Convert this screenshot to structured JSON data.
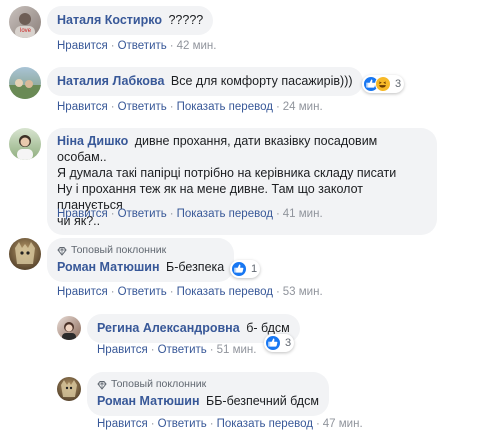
{
  "comments": [
    {
      "author": "Наталя Костирко",
      "text": "?????",
      "actions": {
        "like": "Нравится",
        "reply": "Ответить",
        "time": "42 мин."
      }
    },
    {
      "author": "Наталия Лабкова",
      "text": "Все для комфорту пасажирів)))",
      "reactions_count": "3",
      "actions": {
        "like": "Нравится",
        "reply": "Ответить",
        "translate": "Показать перевод",
        "time": "24 мин."
      }
    },
    {
      "author": "Ніна Дишко",
      "text": "дивне прохання, дати вказівку посадовим особам.. Я думала такі папірці потрібно на керівника складу писати Ну і прохання теж як на мене дивне. Там що заколот планується чи як?..",
      "lines": [
        "дивне прохання, дати вказівку посадовим особам..",
        "Я думала такі папірці потрібно на керівника складу писати",
        "Ну і прохання теж як на мене дивне. Там що заколот планується",
        "чи як?.."
      ],
      "actions": {
        "like": "Нравится",
        "reply": "Ответить",
        "translate": "Показать перевод",
        "time": "41 мин."
      }
    },
    {
      "badge": "Топовый поклонник",
      "author": "Роман Матюшин",
      "text": "Б-безпека",
      "reactions_count": "1",
      "actions": {
        "like": "Нравится",
        "reply": "Ответить",
        "translate": "Показать перевод",
        "time": "53 мин."
      }
    },
    {
      "author": "Регина Александровна",
      "text": "б- бдсм",
      "reactions_count": "3",
      "actions": {
        "like": "Нравится",
        "reply": "Ответить",
        "time": "51 мин."
      }
    },
    {
      "badge": "Топовый поклонник",
      "author": "Роман Матюшин",
      "text": "ББ-безпечний бдсм",
      "actions": {
        "like": "Нравится",
        "reply": "Ответить",
        "translate": "Показать перевод",
        "time": "47 мин."
      }
    }
  ],
  "separator": "·",
  "colors": {
    "link": "#385898",
    "bubble": "#f2f3f5",
    "meta": "#90949c",
    "like_blue": "#1877f2",
    "haha_yellow": "#f7b928"
  }
}
